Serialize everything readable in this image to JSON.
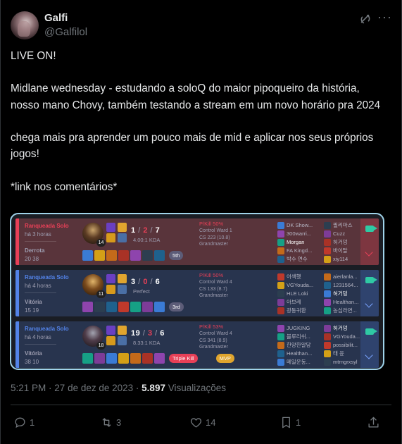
{
  "tweet": {
    "display_name": "Galfi",
    "handle": "@Galfilol",
    "paragraphs": [
      "LIVE ON!",
      "Midlane wednesday - estudando a soloQ do maior pipoqueiro da história, nosso mano Chovy, também testando a stream em um novo horário pra 2024",
      "chega mais pra aprender um pouco mais de mid e aplicar nos seus próprios jogos!",
      "*link nos comentários*"
    ],
    "time": "5:21 PM",
    "date": "27 de dez de 2023",
    "views_count": "5.897",
    "views_label": "Visualizações"
  },
  "actions": {
    "replies": "1",
    "retweets": "3",
    "likes": "14",
    "bookmarks": "1"
  },
  "matches": [
    {
      "queue": "Ranqueada Solo",
      "ago": "há 3 horas",
      "result": "Derrota",
      "duration": "20 38",
      "level": "14",
      "kills": "1",
      "deaths": "2",
      "assists": "7",
      "kda_ratio": "4.00:1 KDA",
      "badges": [
        "5th"
      ],
      "pkill": "P/Kill 50%",
      "ward": "Control Ward 1",
      "cs": "CS 223 (10.8)",
      "rank": "Grandmaster",
      "team1": [
        "DK Show...",
        "300warri...",
        "Morgan",
        "FA Kingd...",
        "박수 연수"
      ],
      "team2": [
        "필리마스",
        "Cuzz",
        "허거덩",
        "바이탈",
        "xiy114"
      ],
      "me": 2
    },
    {
      "queue": "Ranqueada Solo",
      "ago": "há 4 horas",
      "result": "Vitória",
      "duration": "15 19",
      "level": "11",
      "kills": "3",
      "deaths": "0",
      "assists": "6",
      "kda_ratio": "Perfect",
      "badges": [
        "3rd"
      ],
      "pkill": "P/Kill 50%",
      "ward": "Control Ward 4",
      "cs": "CS 133 (8.7)",
      "rank": "Grandmaster",
      "team1": [
        "어색했",
        "VGYouda...",
        "HLE Loki",
        "아브레",
        "광동귀환"
      ],
      "team2": [
        "aierlanla...",
        "1231564...",
        "허거덩",
        "Healthan...",
        "농심라면..."
      ],
      "me": 7
    },
    {
      "queue": "Ranqueada Solo",
      "ago": "há 4 horas",
      "result": "Vitória",
      "duration": "38 10",
      "level": "18",
      "kills": "19",
      "deaths": "3",
      "assists": "6",
      "kda_ratio": "8.33:1 KDA",
      "badges": [
        "Triple Kill",
        "MVP"
      ],
      "pkill": "P/Kill 53%",
      "ward": "Control Ward 4",
      "cs": "CS 341 (8.9)",
      "rank": "Grandmaster",
      "team1": [
        "JUGKING",
        "블루리쉬...",
        "한양한알당",
        "Healthan...",
        "메일운동..."
      ],
      "team2": [
        "허거덩",
        "VGYouda...",
        "possibilit...",
        "태 윤",
        "mtrngrxsyl"
      ],
      "me": 5
    }
  ],
  "colors": {
    "loss": "#e84057",
    "win": "#5383e8",
    "mvp": "#e0a52e",
    "triple": "#e84057"
  }
}
